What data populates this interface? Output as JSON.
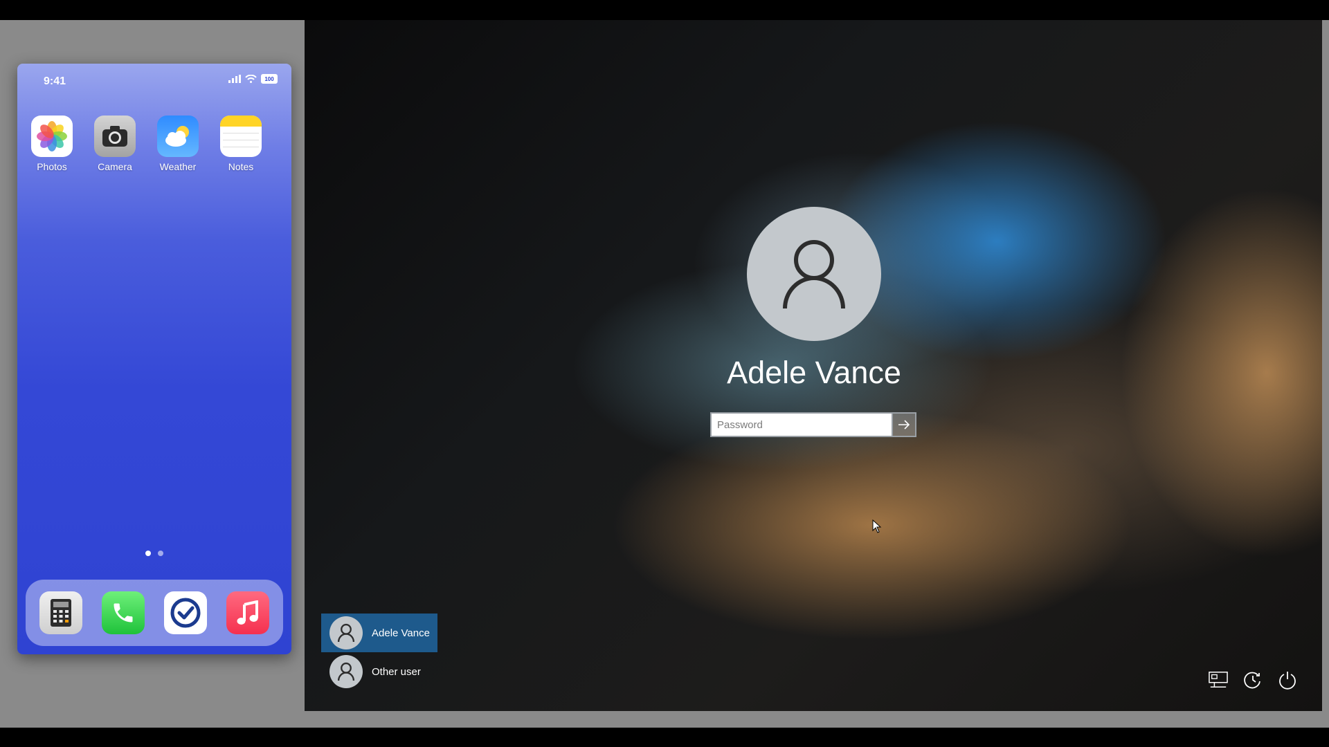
{
  "phone": {
    "status": {
      "time": "9:41",
      "battery": "100"
    },
    "apps": [
      {
        "label": "Photos",
        "icon": "photos-icon"
      },
      {
        "label": "Camera",
        "icon": "camera-icon"
      },
      {
        "label": "Weather",
        "icon": "weather-icon"
      },
      {
        "label": "Notes",
        "icon": "notes-icon"
      }
    ],
    "page_count": 2,
    "active_page": 1,
    "dock": [
      "calculator-icon",
      "phone-icon",
      "tasks-icon",
      "music-icon"
    ]
  },
  "lockscreen": {
    "user_name": "Adele Vance",
    "password_placeholder": "Password",
    "password_value": "",
    "users": [
      {
        "label": "Adele Vance",
        "selected": true
      },
      {
        "label": "Other user",
        "selected": false
      }
    ],
    "bottom_icons": [
      "network-icon",
      "accessibility-icon",
      "power-icon"
    ]
  }
}
